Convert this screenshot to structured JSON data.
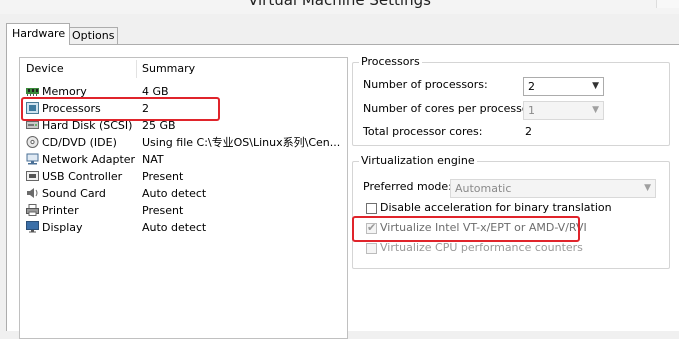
{
  "window": {
    "title": "Virtual Machine Settings"
  },
  "tabs": [
    {
      "label": "Hardware",
      "active": true
    },
    {
      "label": "Options",
      "active": false
    }
  ],
  "device_list": {
    "columns": [
      "Device",
      "Summary"
    ],
    "rows": [
      {
        "icon": "memory-icon",
        "device": "Memory",
        "summary": "4 GB"
      },
      {
        "icon": "processor-icon",
        "device": "Processors",
        "summary": "2",
        "highlighted": true
      },
      {
        "icon": "hard-disk-icon",
        "device": "Hard Disk (SCSI)",
        "summary": "25 GB"
      },
      {
        "icon": "cd-dvd-icon",
        "device": "CD/DVD (IDE)",
        "summary": "Using file C:\\专业OS\\Linux系列\\Cen..."
      },
      {
        "icon": "network-adapter-icon",
        "device": "Network Adapter",
        "summary": "NAT"
      },
      {
        "icon": "usb-icon",
        "device": "USB Controller",
        "summary": "Present"
      },
      {
        "icon": "speaker-icon",
        "device": "Sound Card",
        "summary": "Auto detect"
      },
      {
        "icon": "printer-icon",
        "device": "Printer",
        "summary": "Present"
      },
      {
        "icon": "display-icon",
        "device": "Display",
        "summary": "Auto detect"
      }
    ]
  },
  "processors": {
    "group_title": "Processors",
    "num_processors_label": "Number of processors:",
    "num_processors_value": "2",
    "cores_label": "Number of cores per processor:",
    "cores_value": "1",
    "total_label": "Total processor cores:",
    "total_value": "2"
  },
  "virtualization": {
    "group_title": "Virtualization engine",
    "preferred_mode_label": "Preferred mode:",
    "preferred_mode_value": "Automatic",
    "disable_accel_label": "Disable acceleration for binary translation",
    "disable_accel_checked": false,
    "vtx_label": "Virtualize Intel VT-x/EPT or AMD-V/RVI",
    "vtx_checked": true,
    "cpu_counters_label": "Virtualize CPU performance counters",
    "cpu_counters_checked": false
  },
  "colors": {
    "highlight_border": "#e0242b",
    "window_bg": "#f0f0f0",
    "panel_bg": "#ffffff"
  }
}
